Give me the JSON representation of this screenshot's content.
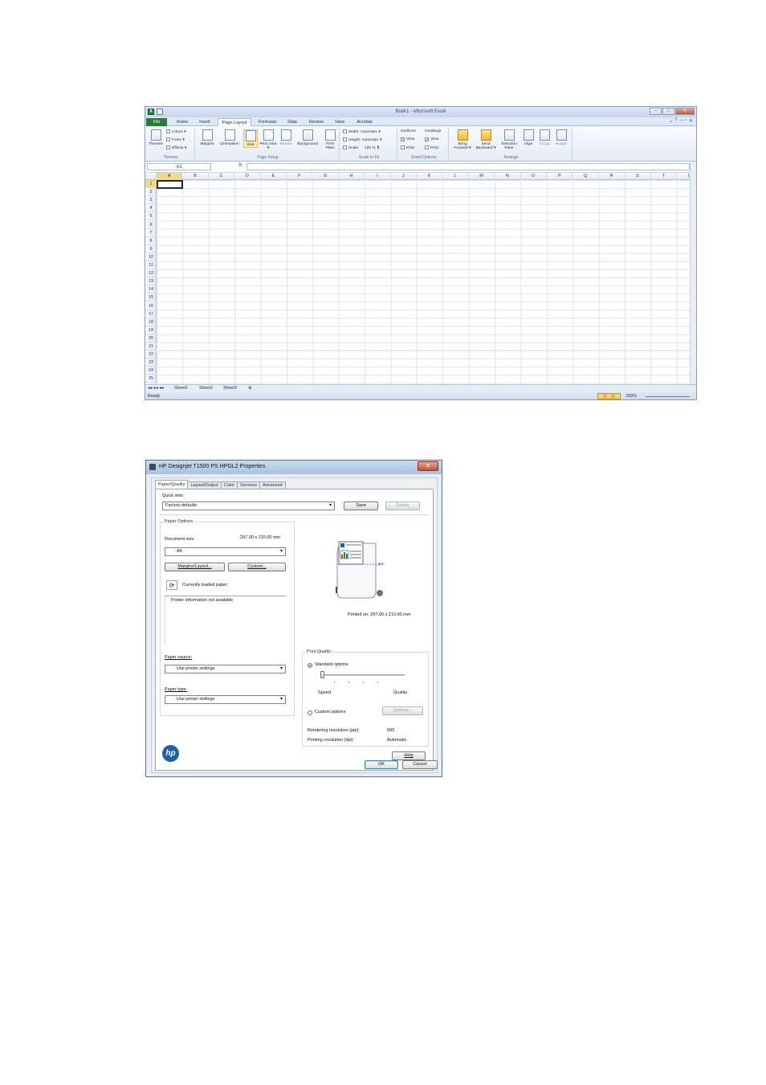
{
  "excel": {
    "window_title": "Book1 - Microsoft Excel",
    "tabs": [
      "File",
      "Home",
      "Insert",
      "Page Layout",
      "Formulas",
      "Data",
      "Review",
      "View",
      "Acrobat"
    ],
    "active_tab": "Page Layout",
    "ribbon": {
      "themes": {
        "themes_label": "Themes",
        "colors": "Colors ▾",
        "fonts": "Fonts ▾",
        "effects": "Effects ▾",
        "group": "Themes"
      },
      "page_setup": {
        "margins": "Margins",
        "orientation": "Orientation",
        "size": "Size",
        "print_area": "Print Area ▾",
        "breaks": "Breaks",
        "background": "Background",
        "print_titles": "Print Titles",
        "group": "Page Setup"
      },
      "scale_to_fit": {
        "width_label": "Width:",
        "width_value": "Automatic",
        "height_label": "Height:",
        "height_value": "Automatic",
        "scale_label": "Scale:",
        "scale_value": "100 %",
        "group": "Scale to Fit"
      },
      "sheet_options": {
        "gridlines": "Gridlines",
        "headings": "Headings",
        "view1": "View",
        "print1": "Print",
        "view2": "View",
        "print2": "Print",
        "group": "Sheet Options"
      },
      "arrange": {
        "bring_forward": "Bring Forward ▾",
        "send_backward": "Send Backward ▾",
        "selection_pane": "Selection Pane",
        "align": "Align",
        "group_btn": "Group",
        "rotate": "Rotate",
        "group": "Arrange"
      }
    },
    "name_box": "A1",
    "fx": "fx",
    "columns": [
      "A",
      "B",
      "C",
      "D",
      "E",
      "F",
      "G",
      "H",
      "I",
      "J",
      "K",
      "L",
      "M",
      "N",
      "O",
      "P",
      "Q",
      "R",
      "S",
      "T",
      "U"
    ],
    "rows": [
      "1",
      "2",
      "3",
      "4",
      "5",
      "6",
      "7",
      "8",
      "9",
      "10",
      "11",
      "12",
      "13",
      "14",
      "15",
      "16",
      "17",
      "18",
      "19",
      "20",
      "21",
      "22",
      "23",
      "24",
      "25"
    ],
    "sheets": [
      "Sheet1",
      "Sheet2",
      "Sheet3"
    ],
    "status": "Ready",
    "zoom": "100%"
  },
  "dialog": {
    "title": "HP Designjet T1500 PS HPGL2 Properties",
    "close": "✕",
    "tabs": [
      "Paper/Quality",
      "Layout/Output",
      "Color",
      "Services",
      "Advanced"
    ],
    "quick_sets_label": "Quick sets:",
    "quick_sets_value": "Factory defaults",
    "save": "Save",
    "delete": "Delete",
    "paper_options": "Paper Options",
    "document_size_label": "Document size:",
    "document_size_dims": "297.00 x 210.00 mm",
    "document_size_value": "A4",
    "margins_layout": "Margins/Layout...",
    "custom": "Custom...",
    "currently_loaded": "Currently loaded paper:",
    "printer_info": "Printer information not available",
    "paper_source_label": "Paper source:",
    "paper_source_value": "Use printer settings",
    "paper_type_label": "Paper type:",
    "paper_type_value": "Use printer settings",
    "printed_on": "Printed on: 297.00 x 210.00 mm",
    "print_quality": "Print Quality",
    "standard_options": "Standard options",
    "speed": "Speed",
    "quality": "Quality",
    "custom_options": "Custom options",
    "settings": "Settings...",
    "rendering_label": "Rendering resolution (ppi):",
    "rendering_value": "600",
    "printing_label": "Printing resolution (dpi):",
    "printing_value": "Automatic",
    "help": "Help",
    "ok": "OK",
    "cancel": "Cancel",
    "hp_logo": "hp",
    "quality_slider_level": 0
  }
}
